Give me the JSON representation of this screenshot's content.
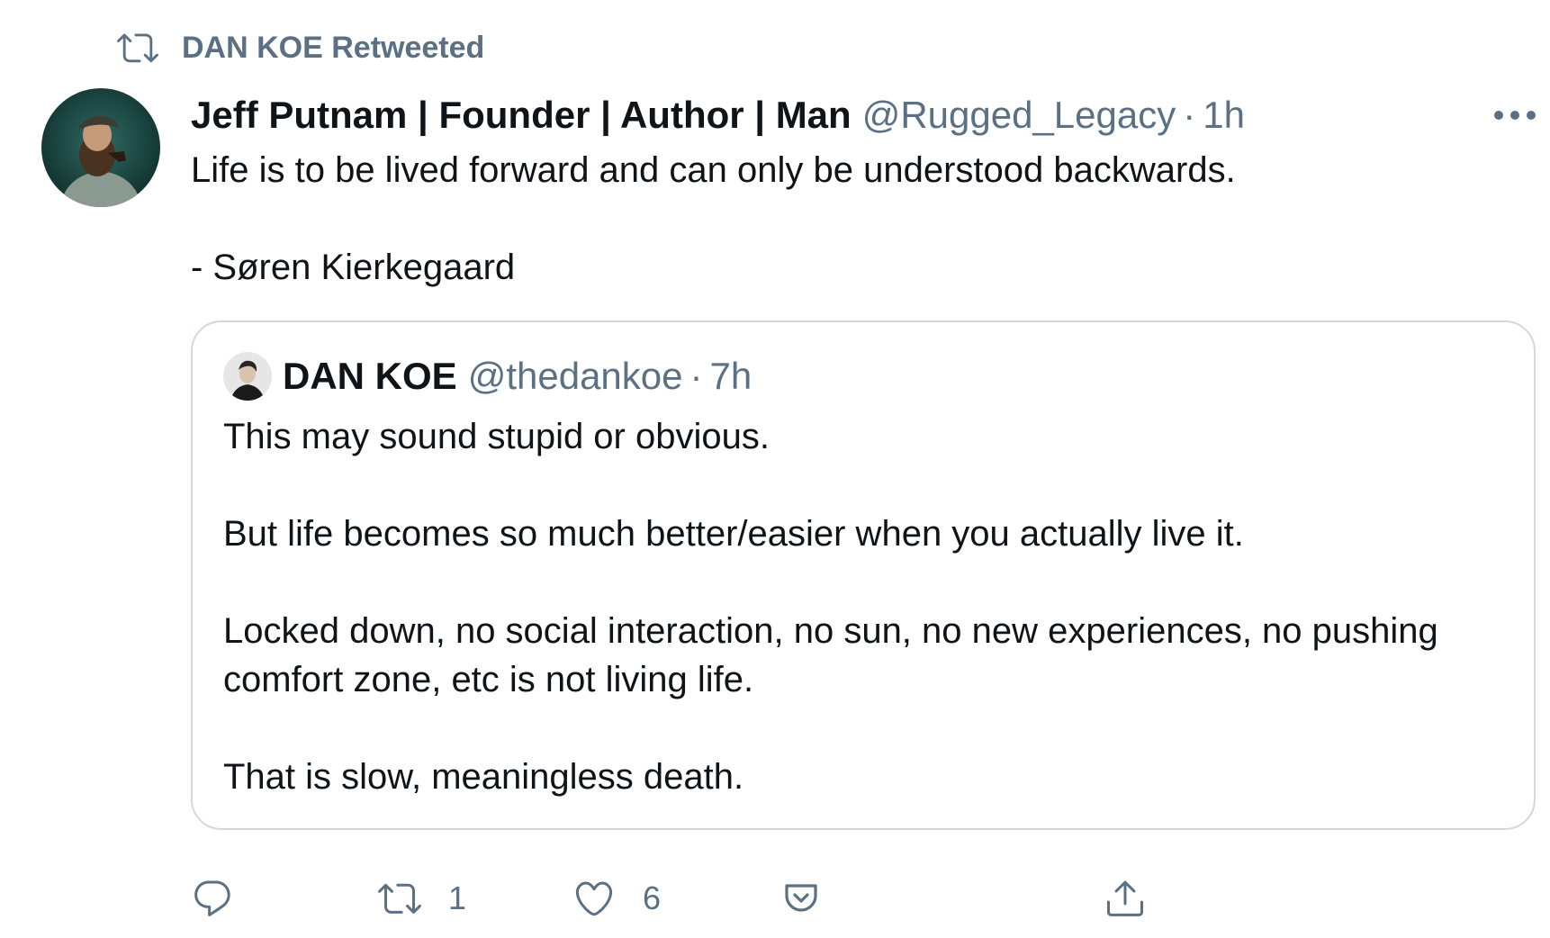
{
  "retweet_context": {
    "label": "DAN KOE Retweeted",
    "icon": "retweet-icon"
  },
  "author": {
    "display_name": "Jeff Putnam | Founder | Author | Man",
    "handle": "@Rugged_Legacy",
    "separator": "·",
    "time": "1h"
  },
  "tweet": {
    "lines": [
      "Life is to be lived forward and can only be understood backwards.",
      "- Søren Kierkegaard"
    ]
  },
  "quote": {
    "display_name": "DAN KOE",
    "handle": "@thedankoe",
    "separator": "·",
    "time": "7h",
    "paragraphs": [
      "This may sound stupid or obvious.",
      "But life becomes so much better/easier when you actually live it.",
      "Locked down, no social interaction, no sun, no new experiences, no pushing comfort zone, etc is not living life.",
      "That is slow, meaningless death."
    ]
  },
  "actions": {
    "reply": {
      "icon": "reply-icon"
    },
    "retweet": {
      "icon": "retweet-icon",
      "count": "1"
    },
    "like": {
      "icon": "heart-icon",
      "count": "6"
    },
    "pocket": {
      "icon": "pocket-icon"
    },
    "share": {
      "icon": "share-icon"
    }
  },
  "colors": {
    "text_primary": "#0f1419",
    "text_secondary": "#5b7083",
    "border": "#cfd9de"
  }
}
